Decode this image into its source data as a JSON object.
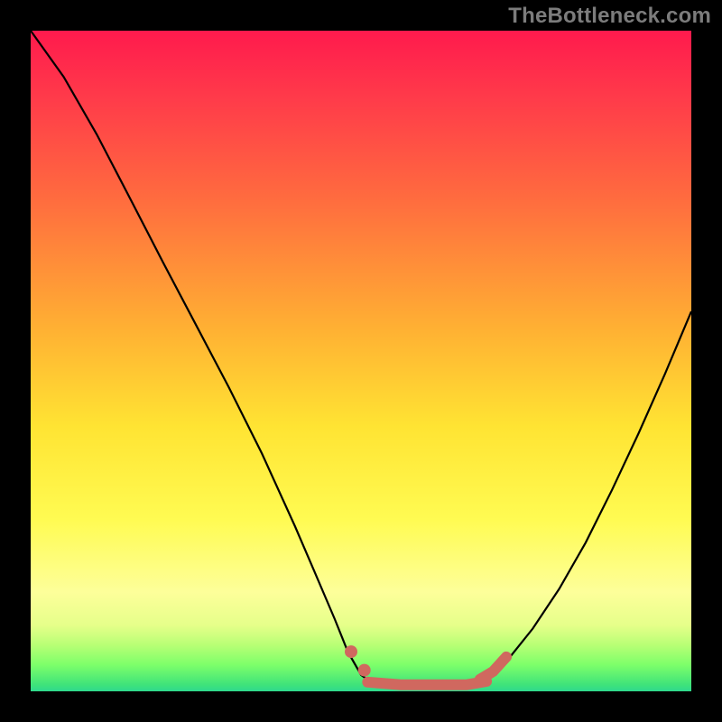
{
  "watermark": "TheBottleneck.com",
  "chart_data": {
    "type": "line",
    "title": "",
    "xlabel": "",
    "ylabel": "",
    "xlim": [
      0,
      1
    ],
    "ylim": [
      0,
      1
    ],
    "series": [
      {
        "name": "curve-left",
        "x": [
          0.0,
          0.05,
          0.1,
          0.15,
          0.2,
          0.25,
          0.3,
          0.35,
          0.4,
          0.43,
          0.46,
          0.48,
          0.5,
          0.52
        ],
        "y": [
          1.0,
          0.93,
          0.843,
          0.747,
          0.65,
          0.555,
          0.46,
          0.36,
          0.25,
          0.18,
          0.11,
          0.06,
          0.025,
          0.01
        ]
      },
      {
        "name": "curve-right",
        "x": [
          0.68,
          0.72,
          0.76,
          0.8,
          0.84,
          0.88,
          0.92,
          0.96,
          1.0
        ],
        "y": [
          0.01,
          0.045,
          0.095,
          0.155,
          0.225,
          0.305,
          0.39,
          0.48,
          0.575
        ]
      },
      {
        "name": "flat-trough",
        "x": [
          0.51,
          0.56,
          0.61,
          0.66,
          0.69
        ],
        "y": [
          0.014,
          0.01,
          0.01,
          0.01,
          0.015
        ]
      },
      {
        "name": "left-markers",
        "x": [
          0.485,
          0.505
        ],
        "y": [
          0.06,
          0.032
        ]
      },
      {
        "name": "right-markers",
        "x": [
          0.68,
          0.7,
          0.72
        ],
        "y": [
          0.018,
          0.03,
          0.052
        ]
      }
    ],
    "colors": {
      "curve": "#000000",
      "overlay": "#d0685f"
    }
  }
}
